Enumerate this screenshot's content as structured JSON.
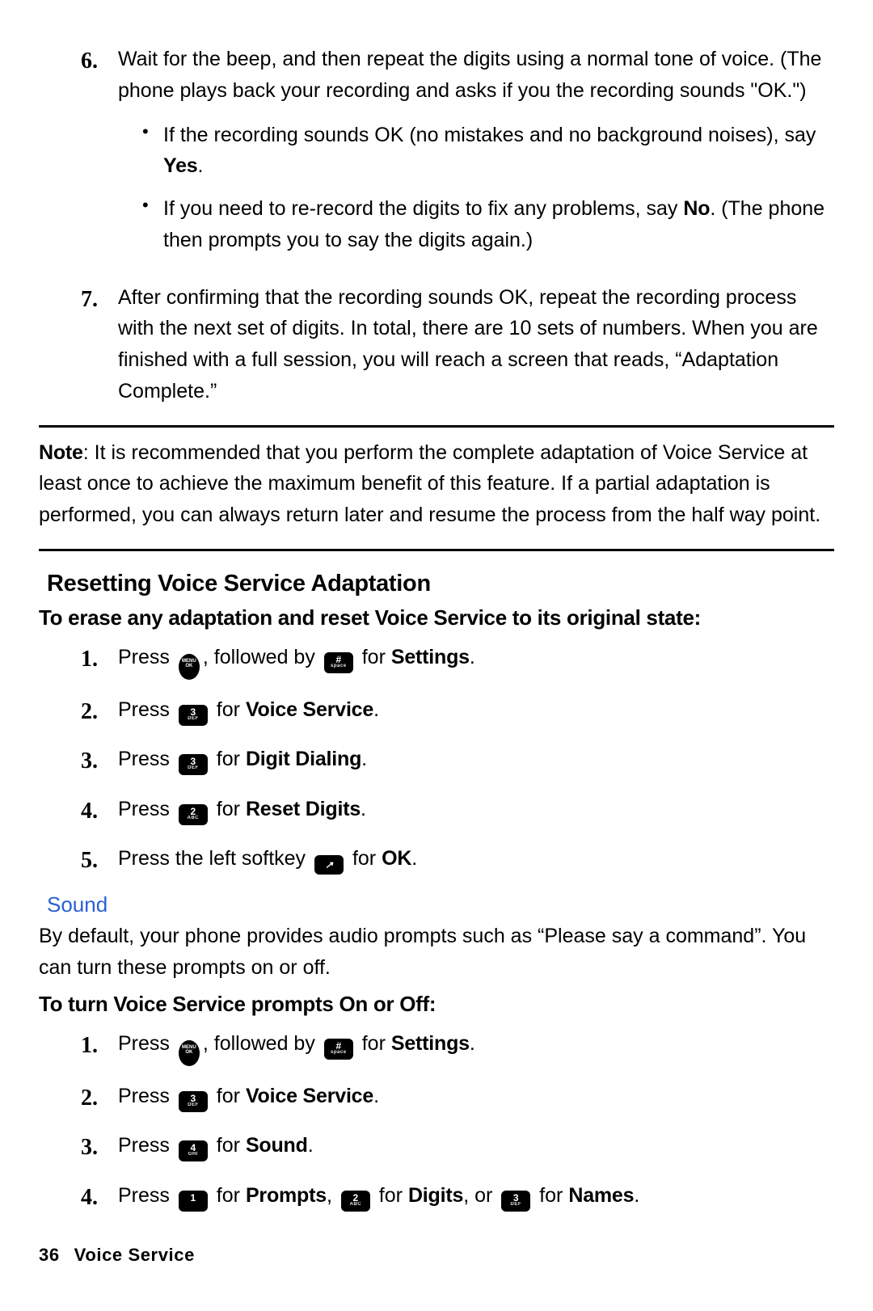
{
  "step6": {
    "num": "6.",
    "text_a": "Wait for the beep, and then repeat the digits using a normal tone of voice. (The phone plays back your recording and asks if you the recording sounds \"OK.\")",
    "bullet1_a": "If the recording sounds OK (no mistakes and no background noises), say ",
    "bullet1_b": "Yes",
    "bullet1_c": ".",
    "bullet2_a": "If you need to re-record the digits to fix any problems, say ",
    "bullet2_b": "No",
    "bullet2_c": ". (The phone then prompts you to say the digits again.)"
  },
  "step7": {
    "num": "7.",
    "text": "After confirming that the recording sounds OK, repeat the recording process with the next set of digits. In total, there are 10 sets of numbers. When you are finished with a full session, you will reach a screen that reads, “Adaptation Complete.”"
  },
  "note": {
    "label": "Note",
    "text": ": It is recommended that you perform the complete adaptation of Voice Service at least once to achieve the maximum benefit of this feature. If a partial adaptation is performed, you can always return later and resume the process from the half way point."
  },
  "reset": {
    "heading": "Resetting Voice Service Adaptation",
    "subheading": "To erase any adaptation and reset Voice Service to its original state:",
    "steps": {
      "n1": "1.",
      "s1a": "Press ",
      "s1b": ", followed by ",
      "s1c": " for ",
      "s1d": "Settings",
      "s1e": ".",
      "n2": "2.",
      "s2a": "Press ",
      "s2b": " for ",
      "s2c": "Voice Service",
      "s2d": ".",
      "n3": "3.",
      "s3a": "Press ",
      "s3b": " for ",
      "s3c": "Digit Dialing",
      "s3d": ".",
      "n4": "4.",
      "s4a": "Press ",
      "s4b": " for ",
      "s4c": "Reset Digits",
      "s4d": ".",
      "n5": "5.",
      "s5a": "Press the left softkey ",
      "s5b": " for ",
      "s5c": "OK",
      "s5d": "."
    }
  },
  "keys": {
    "menu_ok": "MENU\nOK",
    "hash": "#",
    "k1": "1",
    "k2": "2",
    "k3": "3",
    "k4": "4",
    "soft": "↗"
  },
  "sound": {
    "heading": "Sound",
    "para": "By default, your phone provides audio prompts such as “Please say a command”. You can turn these prompts on or off.",
    "subheading": "To turn Voice Service prompts On or Off:",
    "steps": {
      "n1": "1.",
      "s1a": "Press ",
      "s1b": ", followed by ",
      "s1c": " for ",
      "s1d": "Settings",
      "s1e": ".",
      "n2": "2.",
      "s2a": "Press ",
      "s2b": " for ",
      "s2c": "Voice Service",
      "s2d": ".",
      "n3": "3.",
      "s3a": "Press ",
      "s3b": " for ",
      "s3c": "Sound",
      "s3d": ".",
      "n4": "4.",
      "s4a": "Press ",
      "s4b": " for ",
      "s4c": "Prompts",
      "s4d": ", ",
      "s4e": " for ",
      "s4f": "Digits",
      "s4g": ", or ",
      "s4h": " for ",
      "s4i": "Names",
      "s4j": "."
    }
  },
  "footer": {
    "page": "36",
    "title": "Voice Service"
  }
}
